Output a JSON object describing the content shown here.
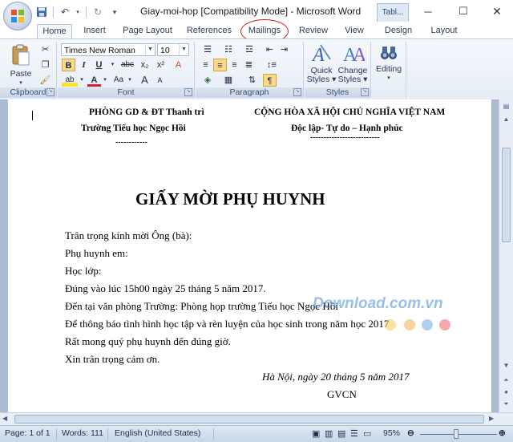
{
  "window": {
    "title": "Giay-moi-hop [Compatibility Mode] - Microsoft Word",
    "context_tab": "Tabl...",
    "minimize": "─",
    "maximize": "☐",
    "close": "✕"
  },
  "qat": {
    "save": "💾",
    "undo": "↶",
    "redo": "↻",
    "customize": "▾"
  },
  "tabs": [
    {
      "label": "Home",
      "active": true
    },
    {
      "label": "Insert"
    },
    {
      "label": "Page Layout"
    },
    {
      "label": "References"
    },
    {
      "label": "Mailings",
      "highlighted": true
    },
    {
      "label": "Review"
    },
    {
      "label": "View"
    },
    {
      "label": "Design"
    },
    {
      "label": "Layout"
    }
  ],
  "ribbon": {
    "clipboard": {
      "label": "Clipboard",
      "paste": "Paste"
    },
    "font": {
      "label": "Font",
      "name": "Times New Roman",
      "size": "10",
      "bold": "B",
      "italic": "I",
      "underline": "U",
      "strike": "abc",
      "subscript": "x₂",
      "superscript": "x²",
      "clear": "A",
      "grow": "A",
      "shrink": "A",
      "highlight": "ab",
      "color": "A",
      "case": "Aa"
    },
    "paragraph": {
      "label": "Paragraph",
      "pilcrow": "¶"
    },
    "styles": {
      "label": "Styles",
      "quick": "Quick\nStyles",
      "change": "Change\nStyles"
    },
    "editing": {
      "label": "Editing"
    }
  },
  "document": {
    "left_header": [
      "PHÒNG GD & ĐT Thanh trì",
      "Trường Tiểu học Ngọc Hồi",
      "------------"
    ],
    "right_header": [
      "CỘNG HÒA XÃ HỘI CHỦ NGHĨA VIỆT NAM",
      "Độc lập- Tự do – Hạnh phúc",
      "--------------------------"
    ],
    "heading": "GIẤY MỜI PHỤ HUYNH",
    "lines": [
      "Trân trọng kính mời Ông (bà):",
      "Phụ huynh em:",
      "Học lớp:",
      "Đúng vào lúc 15h00 ngày 25 tháng 5 năm 2017.",
      "Đến tại văn phòng Trường: Phòng họp trường Tiểu học Ngọc Hồi",
      "Để thông báo tình hình học tập và rèn luyện của học sinh trong năm học 2017",
      "Rất mong quý phụ huynh đến đúng giờ.",
      "Xin trân trọng cảm ơn."
    ],
    "date_line": "Hà Nội, ngày 20 tháng 5  năm 2017",
    "signer": "GVCN"
  },
  "watermark": "Download.com.vn",
  "status": {
    "page": "Page: 1 of 1",
    "words": "Words: 111",
    "language": "English (United States)",
    "zoom": "95%"
  }
}
